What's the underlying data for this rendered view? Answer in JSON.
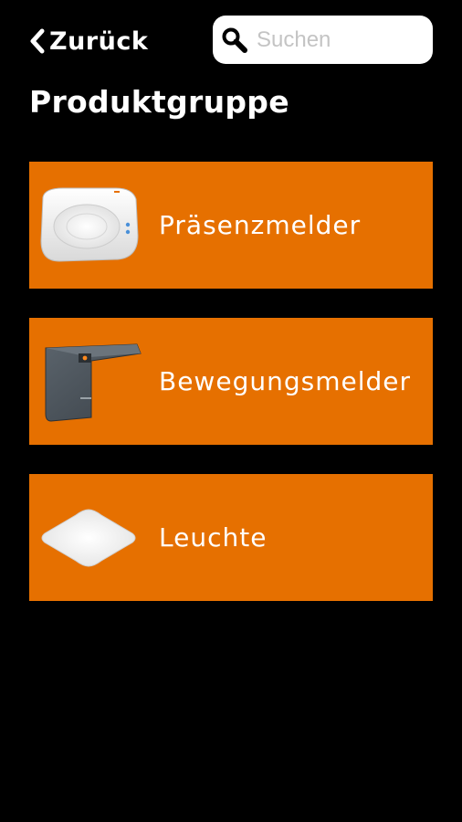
{
  "header": {
    "back_label": "Zurück",
    "search": {
      "placeholder": "Suchen",
      "value": ""
    }
  },
  "page": {
    "title": "Produktgruppe"
  },
  "groups": [
    {
      "label": "Präsenzmelder",
      "icon": "presence-detector-icon"
    },
    {
      "label": "Bewegungsmelder",
      "icon": "motion-detector-icon"
    },
    {
      "label": "Leuchte",
      "icon": "lamp-icon"
    }
  ],
  "colors": {
    "background": "#000000",
    "accent": "#e67000",
    "text": "#ffffff",
    "search_bg": "#ffffff",
    "placeholder": "#c4c4c4"
  }
}
